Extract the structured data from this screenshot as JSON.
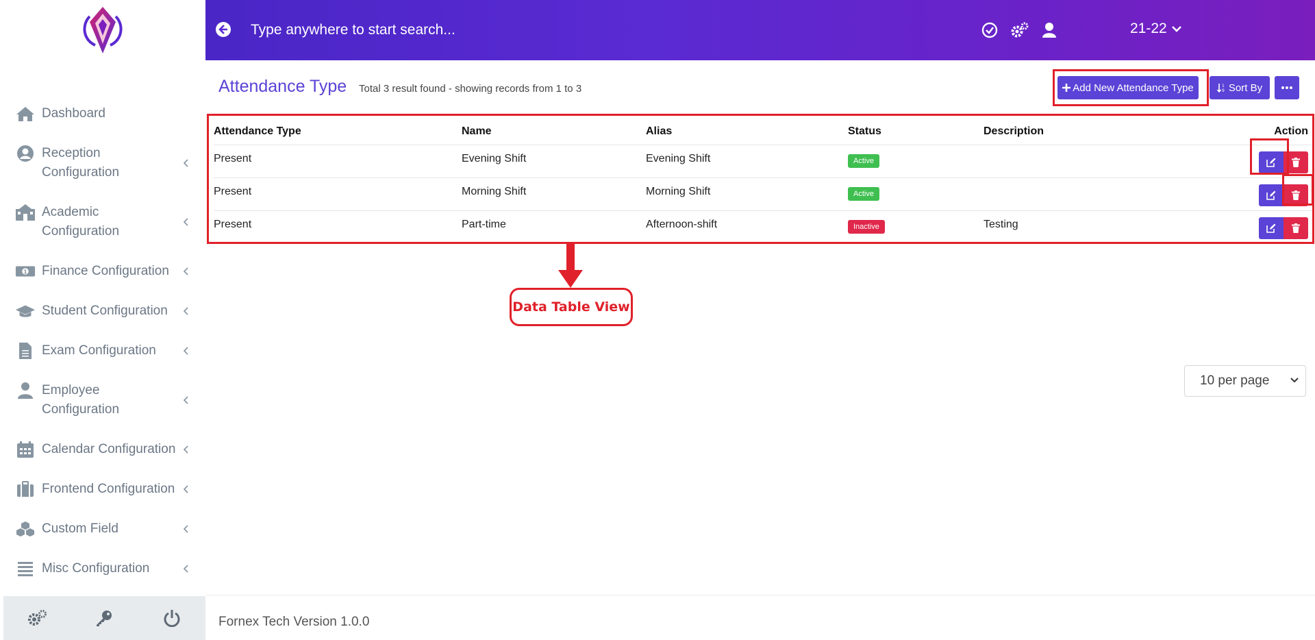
{
  "header": {
    "search_placeholder": "Type anywhere to start search...",
    "year": "21-22"
  },
  "sidebar": {
    "items": [
      {
        "label": "Dashboard",
        "icon": "home-icon"
      },
      {
        "label": "Reception Configuration",
        "icon": "user-circle-icon"
      },
      {
        "label": "Academic Configuration",
        "icon": "school-icon"
      },
      {
        "label": "Finance Configuration",
        "icon": "money-icon"
      },
      {
        "label": "Student Configuration",
        "icon": "graduation-cap-icon"
      },
      {
        "label": "Exam Configuration",
        "icon": "document-icon"
      },
      {
        "label": "Employee Configuration",
        "icon": "employee-icon"
      },
      {
        "label": "Calendar Configuration",
        "icon": "calendar-icon"
      },
      {
        "label": "Frontend Configuration",
        "icon": "briefcase-icon"
      },
      {
        "label": "Custom Field",
        "icon": "cubes-icon"
      },
      {
        "label": "Misc Configuration",
        "icon": "list-icon"
      }
    ],
    "footer_icons": [
      "cogs-icon",
      "key-icon",
      "power-icon"
    ]
  },
  "page": {
    "title": "Attendance Type",
    "result_info": "Total 3 result found - showing records from 1 to 3",
    "add_button": "Add New Attendance Type",
    "sort_button": "Sort By"
  },
  "table": {
    "headers": [
      "Attendance Type",
      "Name",
      "Alias",
      "Status",
      "Description",
      "Action"
    ],
    "rows": [
      {
        "type": "Present",
        "name": "Evening Shift",
        "alias": "Evening Shift",
        "status": "Active",
        "description": ""
      },
      {
        "type": "Present",
        "name": "Morning Shift",
        "alias": "Morning Shift",
        "status": "Active",
        "description": ""
      },
      {
        "type": "Present",
        "name": "Part-time",
        "alias": "Afternoon-shift",
        "status": "Inactive",
        "description": "Testing"
      }
    ]
  },
  "annotation": {
    "label": "Data Table View"
  },
  "pagination": {
    "per_page": "10 per page"
  },
  "footer": {
    "text": "Fornex Tech Version 1.0.0"
  },
  "colors": {
    "accent": "#5a43d6",
    "danger": "#e0284b",
    "success": "#3fbf50",
    "annotation_red": "#e0202a"
  }
}
